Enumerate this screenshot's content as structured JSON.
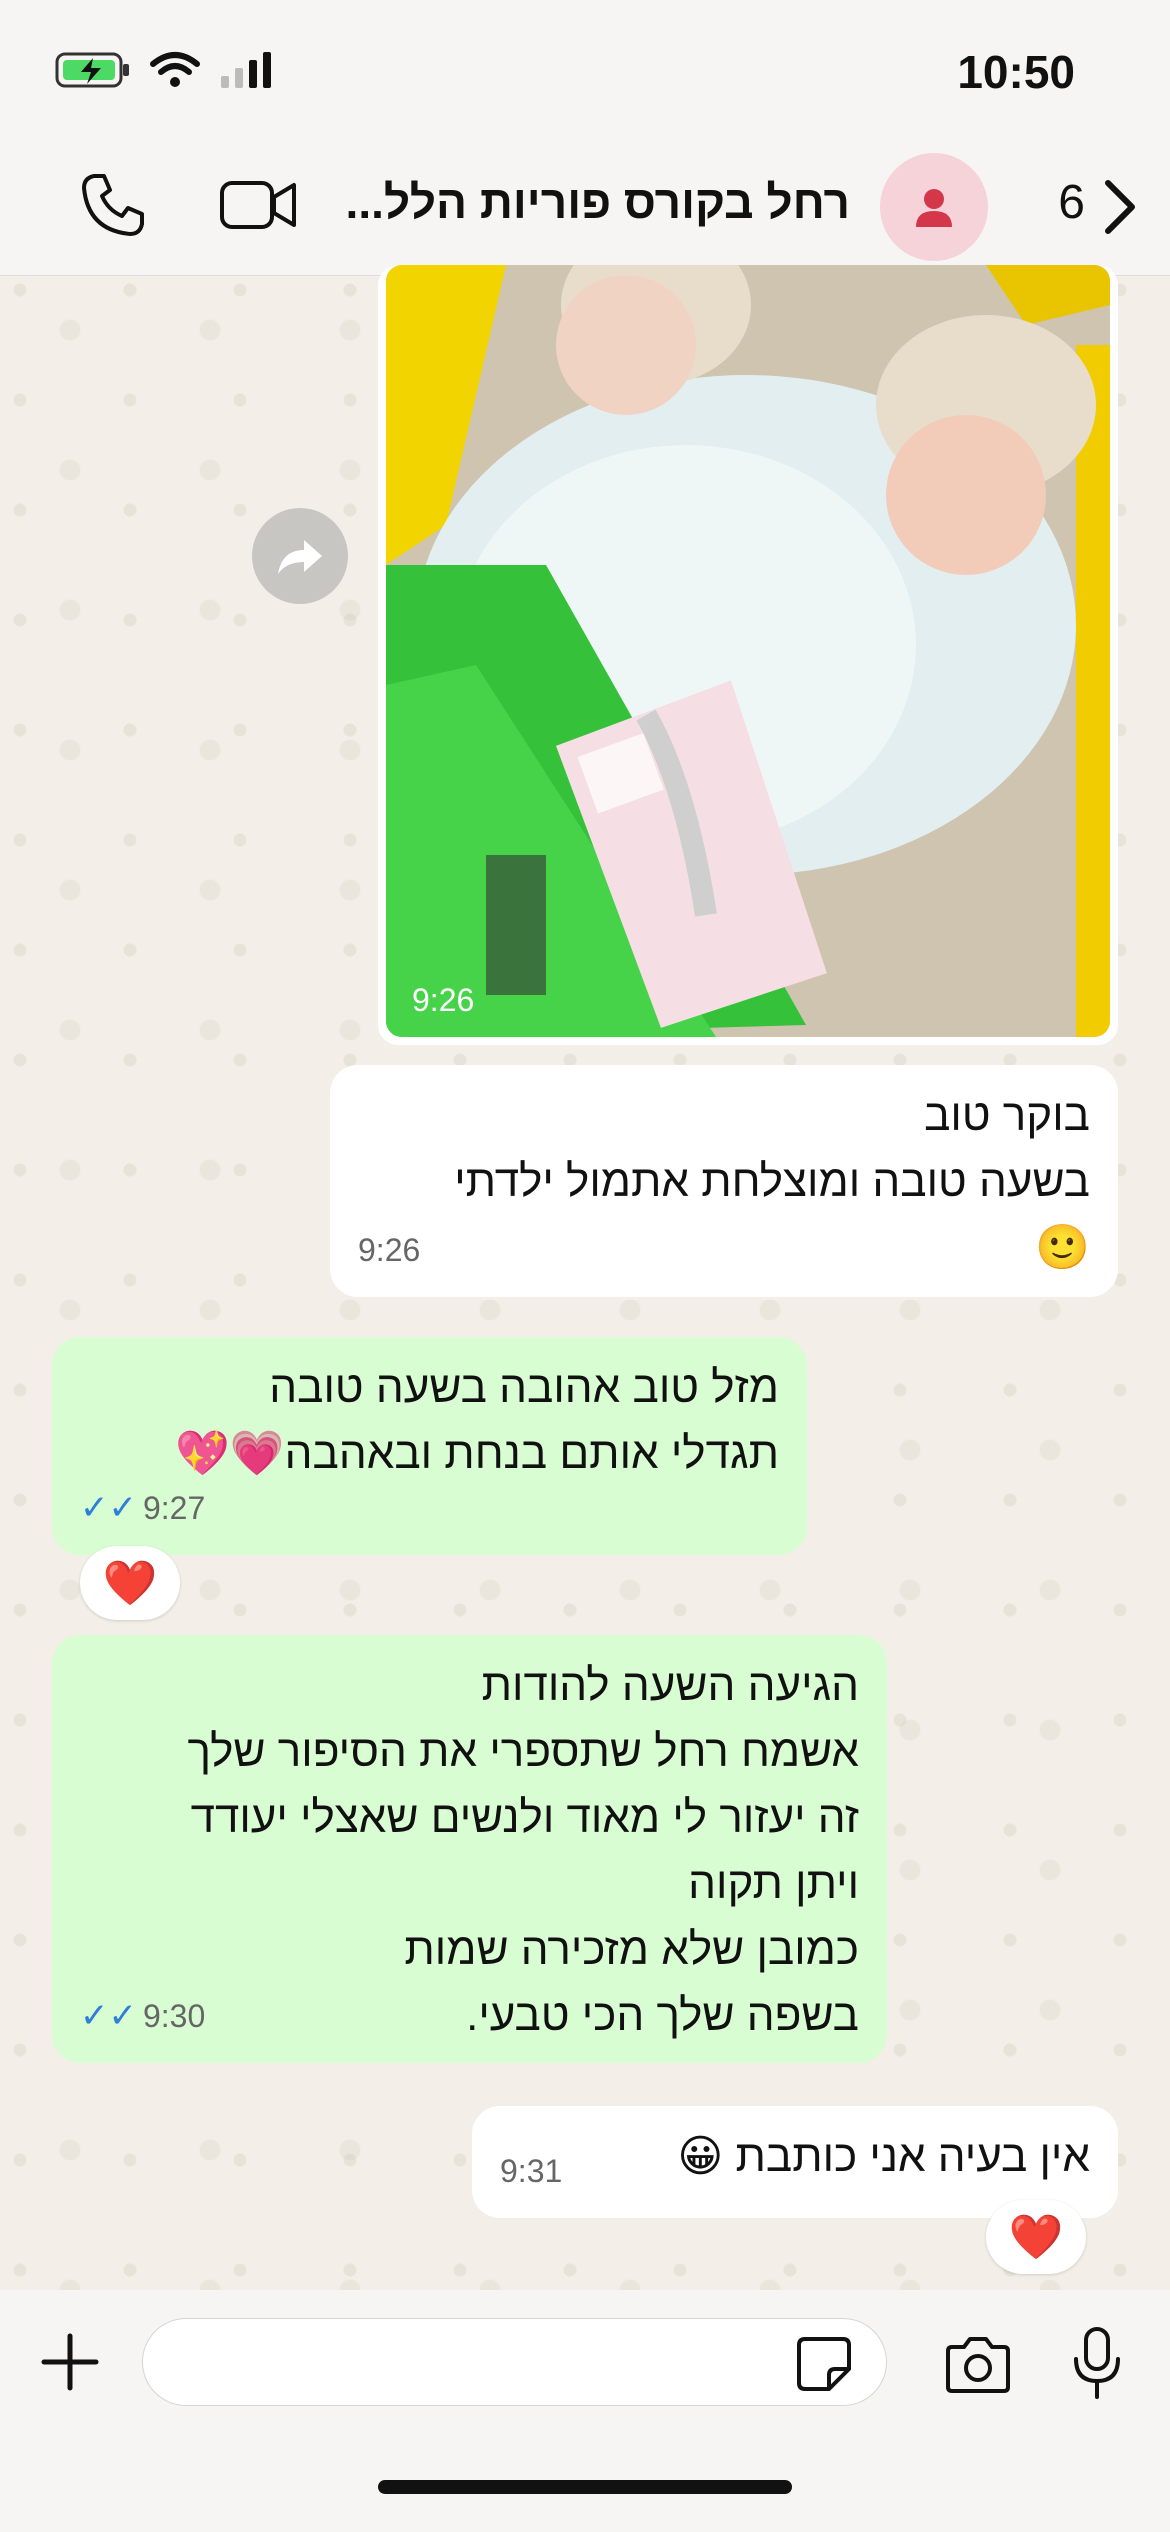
{
  "status_bar": {
    "time": "10:50"
  },
  "header": {
    "back_count": "6",
    "contact_name": "רחל  בקורס פוריות הלל..."
  },
  "messages": [
    {
      "type": "photo",
      "time": "9:26"
    },
    {
      "type": "in",
      "lines": [
        "בוקר טוב",
        "בשעה טובה ומוצלחת אתמול ילדתי",
        "🙂"
      ],
      "time": "9:26"
    },
    {
      "type": "out",
      "lines": [
        "מזל טוב אהובה בשעה טובה",
        "תגדלי אותם בנחת ובאהבה💗💖"
      ],
      "time": "9:27",
      "reaction": "❤️"
    },
    {
      "type": "out",
      "lines": [
        "הגיעה השעה להודות",
        "אשמח רחל שתספרי את הסיפור שלך",
        "זה יעזור לי מאוד ולנשים שאצלי יעודד",
        "ויתן תקוה",
        "כמובן שלא מזכירה שמות",
        "בשפה שלך הכי טבעי."
      ],
      "time": "9:30"
    },
    {
      "type": "in",
      "lines": [
        "אין בעיה אני כותבת 😀"
      ],
      "time": "9:31",
      "reaction": "❤️"
    }
  ],
  "colors": {
    "outgoing": "#d9fdd3",
    "incoming": "#ffffff",
    "read_ticks": "#2f7fd8"
  }
}
